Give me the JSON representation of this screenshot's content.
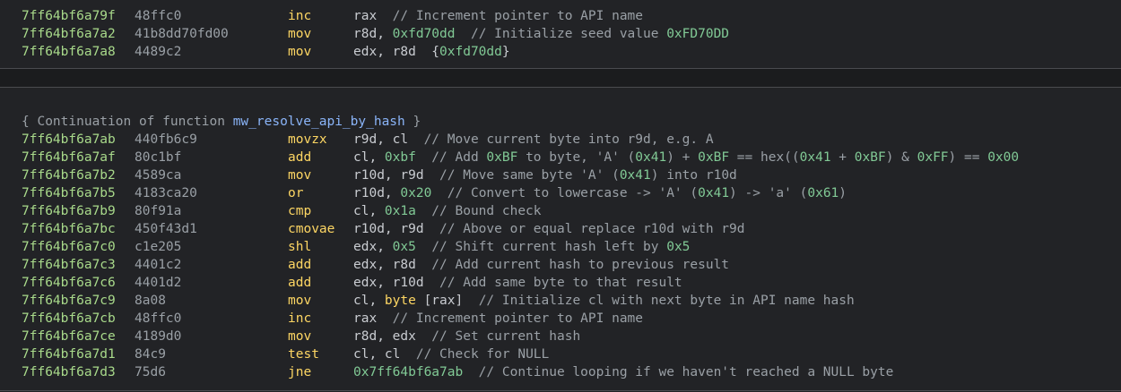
{
  "top_block": {
    "lines": [
      {
        "addr": "7ff64bf6a79f",
        "bytes": "48ffc0",
        "mnemonic": "inc",
        "operands": [
          [
            "rax",
            ""
          ],
          [
            "  // Increment pointer to API name",
            "cmt"
          ]
        ]
      },
      {
        "addr": "7ff64bf6a7a2",
        "bytes": "41b8dd70fd00",
        "mnemonic": "mov",
        "operands": [
          [
            "r8d, ",
            ""
          ],
          [
            "0xfd70dd",
            "hex"
          ],
          [
            "  // Initialize seed value ",
            "cmt"
          ],
          [
            "0xFD70DD",
            "hex"
          ]
        ]
      },
      {
        "addr": "7ff64bf6a7a8",
        "bytes": "4489c2",
        "mnemonic": "mov",
        "operands": [
          [
            "edx, r8d  {",
            ""
          ],
          [
            "0xfd70dd",
            "hex"
          ],
          [
            "}",
            ""
          ]
        ]
      }
    ]
  },
  "bottom_block": {
    "header": {
      "prefix": "{ Continuation of function ",
      "function_name": "mw_resolve_api_by_hash",
      "suffix": " }"
    },
    "lines": [
      {
        "addr": "7ff64bf6a7ab",
        "bytes": "440fb6c9",
        "mnemonic": "movzx",
        "operands": [
          [
            "r9d, cl",
            ""
          ],
          [
            "  // Move current byte into r9d, e.g. A",
            "cmt"
          ]
        ]
      },
      {
        "addr": "7ff64bf6a7af",
        "bytes": "80c1bf",
        "mnemonic": "add",
        "operands": [
          [
            "cl, ",
            ""
          ],
          [
            "0xbf",
            "hex"
          ],
          [
            "  // Add ",
            "cmt"
          ],
          [
            "0xBF",
            "hex"
          ],
          [
            " to byte, 'A' (",
            "cmt"
          ],
          [
            "0x41",
            "hex"
          ],
          [
            ") + ",
            "cmt"
          ],
          [
            "0xBF",
            "hex"
          ],
          [
            " == hex((",
            "cmt"
          ],
          [
            "0x41",
            "hex"
          ],
          [
            " + ",
            "cmt"
          ],
          [
            "0xBF",
            "hex"
          ],
          [
            ") & ",
            "cmt"
          ],
          [
            "0xFF",
            "hex"
          ],
          [
            ") == ",
            "cmt"
          ],
          [
            "0x00",
            "hex"
          ]
        ]
      },
      {
        "addr": "7ff64bf6a7b2",
        "bytes": "4589ca",
        "mnemonic": "mov",
        "operands": [
          [
            "r10d, r9d",
            ""
          ],
          [
            "  // Move same byte 'A' (",
            "cmt"
          ],
          [
            "0x41",
            "hex"
          ],
          [
            ") into r10d",
            "cmt"
          ]
        ]
      },
      {
        "addr": "7ff64bf6a7b5",
        "bytes": "4183ca20",
        "mnemonic": "or",
        "operands": [
          [
            "r10d, ",
            ""
          ],
          [
            "0x20",
            "hex"
          ],
          [
            "  // Convert to lowercase -> 'A' (",
            "cmt"
          ],
          [
            "0x41",
            "hex"
          ],
          [
            ") -> 'a' (",
            "cmt"
          ],
          [
            "0x61",
            "hex"
          ],
          [
            ")",
            "cmt"
          ]
        ]
      },
      {
        "addr": "7ff64bf6a7b9",
        "bytes": "80f91a",
        "mnemonic": "cmp",
        "operands": [
          [
            "cl, ",
            ""
          ],
          [
            "0x1a",
            "hex"
          ],
          [
            "  // Bound check",
            "cmt"
          ]
        ]
      },
      {
        "addr": "7ff64bf6a7bc",
        "bytes": "450f43d1",
        "mnemonic": "cmovae",
        "operands": [
          [
            "r10d, r9d",
            ""
          ],
          [
            "  // Above or equal replace r10d with r9d",
            "cmt"
          ]
        ]
      },
      {
        "addr": "7ff64bf6a7c0",
        "bytes": "c1e205",
        "mnemonic": "shl",
        "operands": [
          [
            "edx, ",
            ""
          ],
          [
            "0x5",
            "hex"
          ],
          [
            "  // Shift current hash left by ",
            "cmt"
          ],
          [
            "0x5",
            "hex"
          ]
        ]
      },
      {
        "addr": "7ff64bf6a7c3",
        "bytes": "4401c2",
        "mnemonic": "add",
        "operands": [
          [
            "edx, r8d",
            ""
          ],
          [
            "  // Add current hash to previous result",
            "cmt"
          ]
        ]
      },
      {
        "addr": "7ff64bf6a7c6",
        "bytes": "4401d2",
        "mnemonic": "add",
        "operands": [
          [
            "edx, r10d",
            ""
          ],
          [
            "  // Add same byte to that result",
            "cmt"
          ]
        ]
      },
      {
        "addr": "7ff64bf6a7c9",
        "bytes": "8a08",
        "mnemonic": "mov",
        "operands": [
          [
            "cl, ",
            ""
          ],
          [
            "byte",
            "kw"
          ],
          [
            " [rax]",
            ""
          ],
          [
            "  // Initialize cl with next byte in API name hash",
            "cmt"
          ]
        ]
      },
      {
        "addr": "7ff64bf6a7cb",
        "bytes": "48ffc0",
        "mnemonic": "inc",
        "operands": [
          [
            "rax",
            ""
          ],
          [
            "  // Increment pointer to API name",
            "cmt"
          ]
        ]
      },
      {
        "addr": "7ff64bf6a7ce",
        "bytes": "4189d0",
        "mnemonic": "mov",
        "operands": [
          [
            "r8d, edx",
            ""
          ],
          [
            "  // Set current hash",
            "cmt"
          ]
        ]
      },
      {
        "addr": "7ff64bf6a7d1",
        "bytes": "84c9",
        "mnemonic": "test",
        "operands": [
          [
            "cl, cl",
            ""
          ],
          [
            "  // Check for NULL",
            "cmt"
          ]
        ]
      },
      {
        "addr": "7ff64bf6a7d3",
        "bytes": "75d6",
        "mnemonic": "jne",
        "operands": [
          [
            "0x7ff64bf6a7ab",
            "hex"
          ],
          [
            "  // Continue looping if we haven't reached a NULL byte",
            "cmt"
          ]
        ]
      }
    ]
  }
}
